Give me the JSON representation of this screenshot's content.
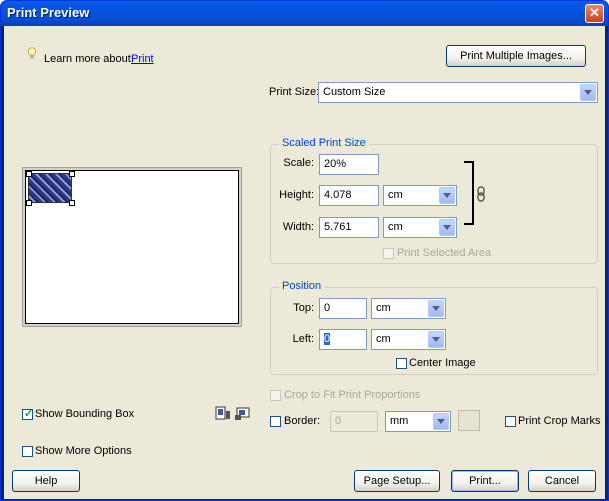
{
  "window": {
    "title": "Print Preview",
    "close_glyph": "✕"
  },
  "learn": {
    "label": "Learn more about:",
    "link": "Print"
  },
  "buttons": {
    "print_multiple": "Print Multiple Images...",
    "help": "Help",
    "page_setup": "Page Setup...",
    "print": "Print...",
    "cancel": "Cancel"
  },
  "print_size": {
    "label": "Print Size:",
    "value": "Custom Size"
  },
  "scaled": {
    "title": "Scaled Print Size",
    "scale_label": "Scale:",
    "scale_value": "20%",
    "height_label": "Height:",
    "height_value": "4.078",
    "height_unit": "cm",
    "width_label": "Width:",
    "width_value": "5.761",
    "width_unit": "cm",
    "print_selected_area": "Print Selected Area"
  },
  "position": {
    "title": "Position",
    "top_label": "Top:",
    "top_value": "0",
    "top_unit": "cm",
    "left_label": "Left:",
    "left_value": "0",
    "left_unit": "cm",
    "center_image": "Center Image"
  },
  "options": {
    "crop_to_fit": "Crop to Fit Print Proportions",
    "border_label": "Border:",
    "border_value": "0",
    "border_unit": "mm",
    "print_crop_marks": "Print Crop Marks",
    "show_bounding_box": "Show Bounding Box",
    "show_more_options": "Show More Options"
  },
  "state": {
    "show_bounding_box": true
  }
}
